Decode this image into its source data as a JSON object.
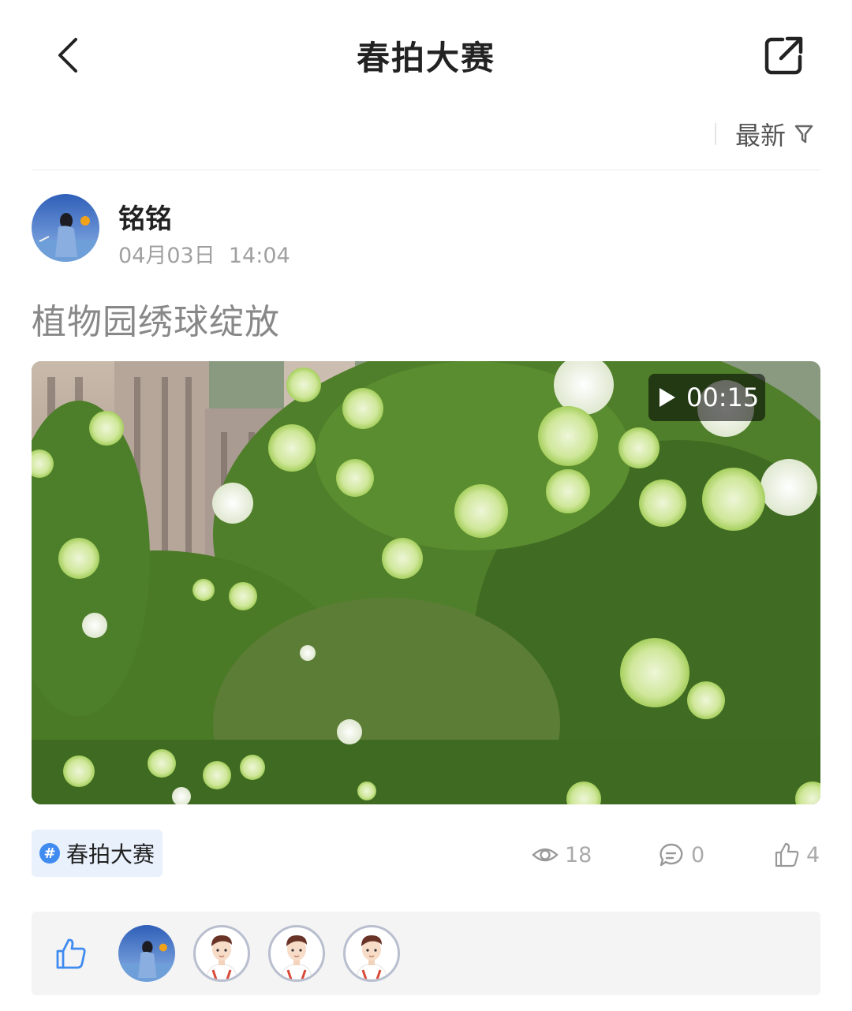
{
  "header": {
    "title": "春拍大赛",
    "back_icon": "chevron-left-icon",
    "share_icon": "share-external-icon"
  },
  "sort": {
    "label": "最新",
    "icon": "filter-icon"
  },
  "post": {
    "author": "铭铭",
    "time": "04月03日  14:04",
    "text": "植物园绣球绽放",
    "video": {
      "duration": "00:15",
      "icon": "play-icon"
    },
    "topic": {
      "label": "春拍大赛",
      "icon": "hashtag-icon"
    },
    "stats": {
      "views": "18",
      "comments": "0",
      "likes": "4"
    }
  },
  "likers": {
    "icon": "thumbs-up-icon",
    "count_avatars_shown": 4
  },
  "colors": {
    "accent": "#3f8bf0",
    "tag_bg": "#e9f1fd",
    "muted_text": "#a0a0a0",
    "likers_bg": "#f4f4f4"
  }
}
